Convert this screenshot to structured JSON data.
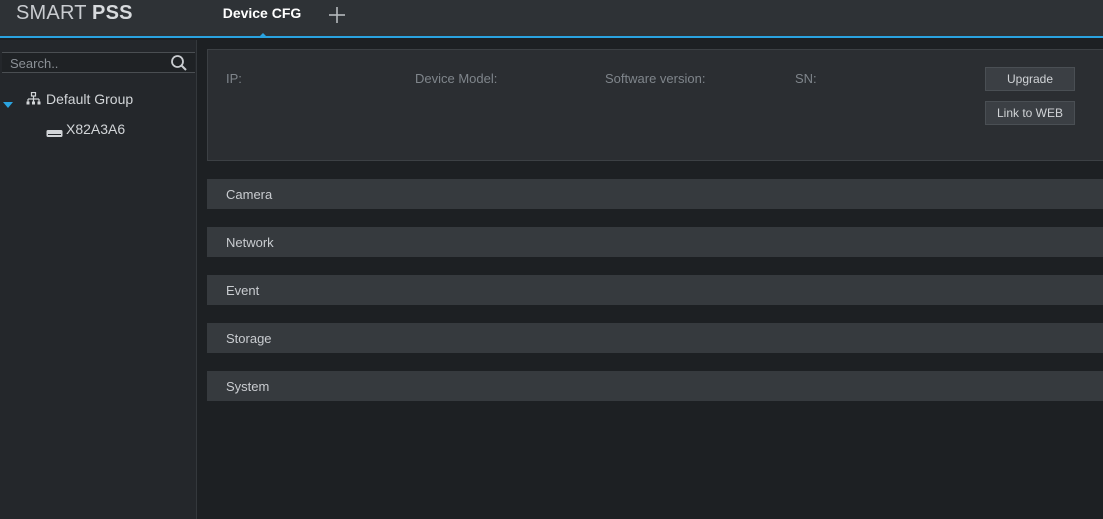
{
  "app": {
    "logo_part1": "SMART ",
    "logo_part2": "PSS"
  },
  "tabs": [
    {
      "label": "Device CFG",
      "active": true
    }
  ],
  "add_tab_icon": "plus-icon",
  "sidebar": {
    "search": {
      "placeholder": "Search..",
      "value": "",
      "icon": "search-icon"
    },
    "tree": {
      "group": {
        "label": "Default Group",
        "expanded": true,
        "icon": "device-group-icon"
      },
      "devices": [
        {
          "label": "X82A3A6",
          "icon": "dvr-device-icon"
        }
      ]
    }
  },
  "device_info": {
    "ip_label": "IP:",
    "model_label": "Device Model:",
    "software_label": "Software version:",
    "sn_label": "SN:",
    "upgrade_button": "Upgrade",
    "link_web_button": "Link to WEB"
  },
  "sections": [
    {
      "label": "Camera"
    },
    {
      "label": "Network"
    },
    {
      "label": "Event"
    },
    {
      "label": "Storage"
    },
    {
      "label": "System"
    }
  ],
  "colors": {
    "accent": "#2aa3e0",
    "background": "#1d2023",
    "topbar": "#2e3236",
    "section_bar": "#363a3e"
  }
}
